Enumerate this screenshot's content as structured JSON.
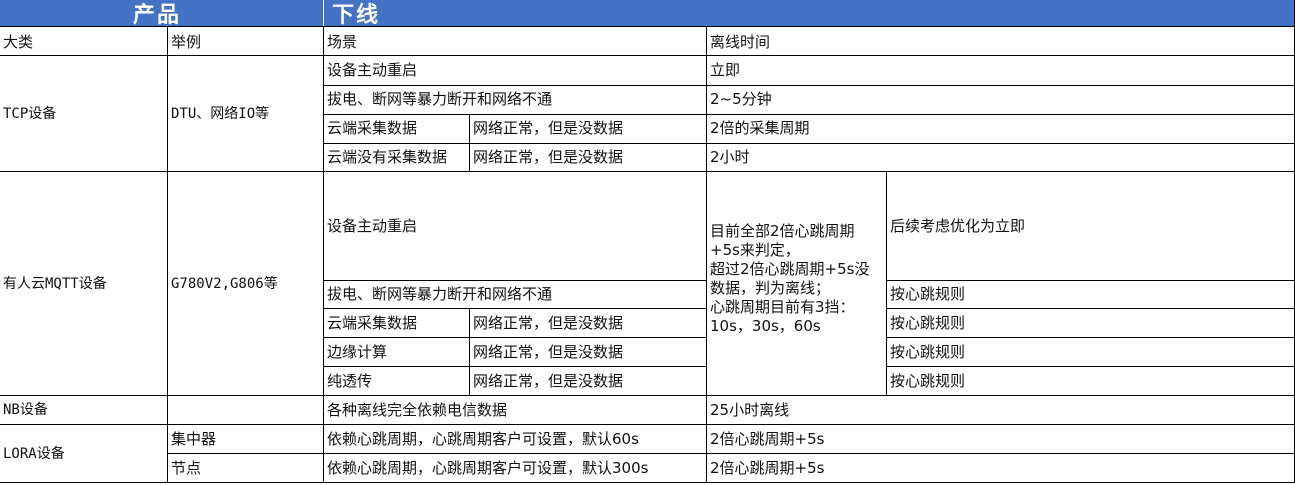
{
  "header": {
    "product": "产品",
    "offline": "下线"
  },
  "columns": {
    "category": "大类",
    "example": "举例",
    "scenario": "场景",
    "offline_time": "离线时间"
  },
  "tcp": {
    "category": "TCP设备",
    "example": "DTU、网络IO等",
    "rows": [
      {
        "scenario": "设备主动重启",
        "time": "立即"
      },
      {
        "scenario": "拔电、断网等暴力断开和网络不通",
        "time": "2~5分钟"
      },
      {
        "scenario": "云端采集数据",
        "detail": "网络正常，但是没数据",
        "time": "2倍的采集周期"
      },
      {
        "scenario": "云端没有采集数据",
        "detail": "网络正常，但是没数据",
        "time": "2小时"
      }
    ]
  },
  "mqtt": {
    "category": "有人云MQTT设备",
    "example": "G780V2,G806等",
    "rule_lines": [
      "目前全部2倍心跳周期",
      "+5s来判定，",
      "超过2倍心跳周期+5s没",
      "数据，判为离线；",
      "心跳周期目前有3挡：",
      "10s，30s，60s"
    ],
    "rows": [
      {
        "scenario": "设备主动重启",
        "note": "后续考虑优化为立即"
      },
      {
        "scenario": "拔电、断网等暴力断开和网络不通",
        "note": "按心跳规则"
      },
      {
        "scenario": "云端采集数据",
        "detail": "网络正常，但是没数据",
        "note": "按心跳规则"
      },
      {
        "scenario": "边缘计算",
        "detail": "网络正常，但是没数据",
        "note": "按心跳规则"
      },
      {
        "scenario": "纯透传",
        "detail": "网络正常，但是没数据",
        "note": "按心跳规则"
      }
    ]
  },
  "nb": {
    "category": "NB设备",
    "scenario": "各种离线完全依赖电信数据",
    "time": "25小时离线"
  },
  "lora": {
    "category": "LORA设备",
    "rows": [
      {
        "sub": "集中器",
        "scenario": "依赖心跳周期，心跳周期客户可设置，默认60s",
        "time": "2倍心跳周期+5s"
      },
      {
        "sub": "节点",
        "scenario": "依赖心跳周期，心跳周期客户可设置，默认300s",
        "time": "2倍心跳周期+5s"
      }
    ]
  }
}
